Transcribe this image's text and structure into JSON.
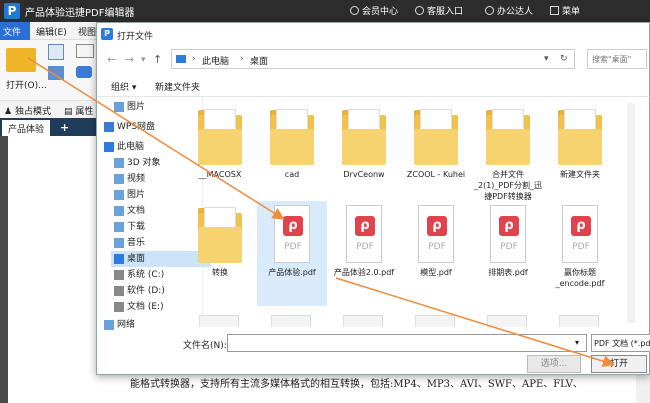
{
  "app": {
    "title": "产品体验迅捷PDF编辑器",
    "logo": "P",
    "topbar": [
      "会员中心",
      "客服入口",
      "办公达人",
      "菜单"
    ],
    "menu": [
      "文件",
      "编辑(E)",
      "视图"
    ],
    "open_label": "打开(O)...",
    "toolbar2": [
      "独占模式",
      "属性"
    ],
    "tab": "产品体验",
    "tab_add": "+"
  },
  "dialog": {
    "title": "打开文件",
    "icon": "P",
    "breadcrumb": [
      "此电脑",
      "桌面"
    ],
    "search_placeholder": "搜索\"桌面\"",
    "organize": "组织 ▾",
    "new_folder": "新建文件夹",
    "nav": [
      {
        "label": "图片",
        "icon": "pictures-icon"
      },
      {
        "label": "WPS网盘",
        "icon": "cloud-icon"
      },
      {
        "label": "此电脑",
        "icon": "computer-icon"
      },
      {
        "label": "3D 对象",
        "icon": "cube-icon"
      },
      {
        "label": "视频",
        "icon": "video-icon"
      },
      {
        "label": "图片",
        "icon": "pictures-icon"
      },
      {
        "label": "文档",
        "icon": "documents-icon"
      },
      {
        "label": "下载",
        "icon": "download-icon"
      },
      {
        "label": "音乐",
        "icon": "music-icon"
      },
      {
        "label": "桌面",
        "icon": "desktop-icon"
      },
      {
        "label": "系统 (C:)",
        "icon": "drive-icon"
      },
      {
        "label": "软件 (D:)",
        "icon": "drive-icon"
      },
      {
        "label": "文档 (E:)",
        "icon": "drive-icon"
      },
      {
        "label": "网络",
        "icon": "network-icon"
      }
    ],
    "files_row1": [
      {
        "name": "__MACOSX",
        "kind": "folder"
      },
      {
        "name": "cad",
        "kind": "folder"
      },
      {
        "name": "DrvCeonw",
        "kind": "folder"
      },
      {
        "name": "ZCOOL - Kuhei",
        "kind": "folder"
      },
      {
        "name": "合并文件_2(1)_PDF分割_迅捷PDF转换器",
        "kind": "folder"
      },
      {
        "name": "新建文件夹",
        "kind": "folder"
      }
    ],
    "files_row2": [
      {
        "name": "转换",
        "kind": "folder"
      },
      {
        "name": "产品体验.pdf",
        "kind": "pdf"
      },
      {
        "name": "产品体验2.0.pdf",
        "kind": "pdf"
      },
      {
        "name": "模型.pdf",
        "kind": "pdf"
      },
      {
        "name": "排期表.pdf",
        "kind": "pdf"
      },
      {
        "name": "赢你标题_encode.pdf",
        "kind": "pdf"
      }
    ],
    "pdf_label": "PDF",
    "filename_label": "文件名(N):",
    "filename_value": "",
    "filetype": "PDF 文档 (*.pdf)",
    "select_button": "选项...",
    "open_button": "打开"
  },
  "background_text": "能格式转换器，支持所有主流多媒体格式的相互转换，包括:MP4、MP3、AVI、SWF、APE、FLV、"
}
